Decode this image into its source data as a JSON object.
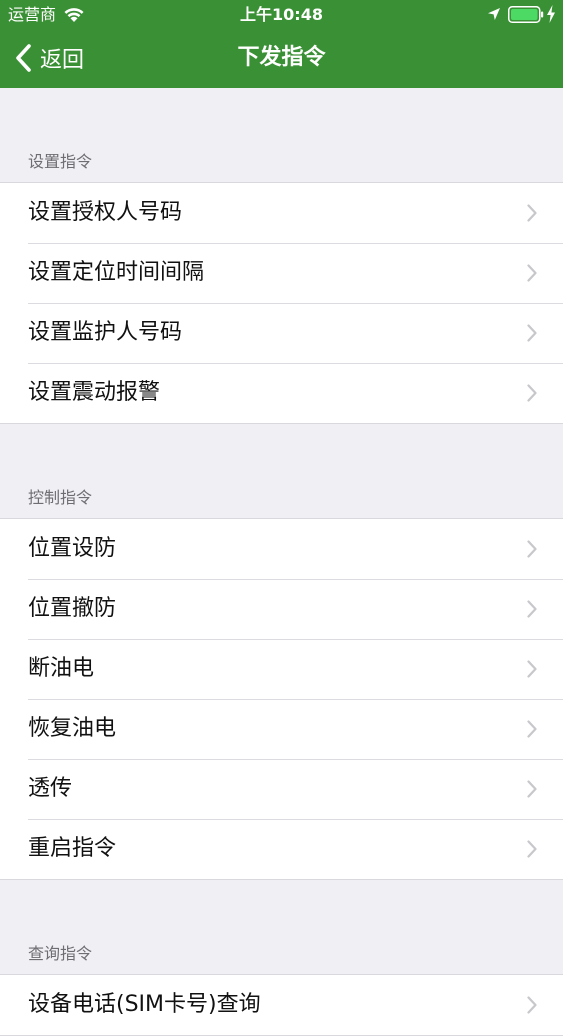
{
  "status_bar": {
    "carrier": "运营商",
    "time": "上午10:48"
  },
  "nav": {
    "back_label": "返回",
    "title": "下发指令"
  },
  "colors": {
    "nav_background": "#3a9135",
    "page_background": "#efeff4",
    "battery_fill": "#4cd964"
  },
  "icons": [
    "wifi-icon",
    "location-arrow-icon",
    "battery-icon",
    "charging-bolt-icon",
    "back-chevron-icon",
    "chevron-right-icon"
  ],
  "sections": [
    {
      "header": "设置指令",
      "items": [
        "设置授权人号码",
        "设置定位时间间隔",
        "设置监护人号码",
        "设置震动报警"
      ]
    },
    {
      "header": "控制指令",
      "items": [
        "位置设防",
        "位置撤防",
        "断油电",
        "恢复油电",
        "透传",
        "重启指令"
      ]
    },
    {
      "header": "查询指令",
      "items": [
        "设备电话(SIM卡号)查询"
      ]
    }
  ]
}
